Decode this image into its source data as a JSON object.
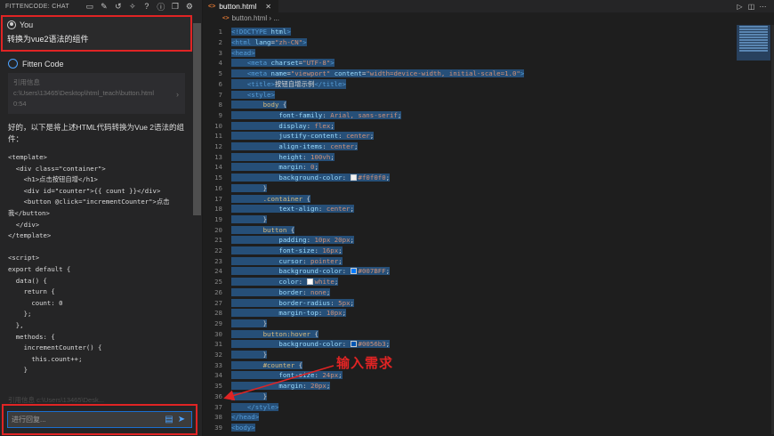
{
  "chat": {
    "header_title": "FITTENCODE: CHAT",
    "header_icons": [
      "chat-bubble-icon",
      "edit-icon",
      "history-icon",
      "wand-icon",
      "help-icon",
      "info-icon",
      "copy-window-icon",
      "gear-icon"
    ],
    "user": {
      "name": "You",
      "message": "转换为vue2语法的组件"
    },
    "bot": {
      "name": "Fitten Code"
    },
    "reference": {
      "label": "引用信息",
      "path": "c:\\Users\\13465\\Desktop\\html_teach\\button.html",
      "range": "0:54"
    },
    "answer_intro": "好的，以下是将上述HTML代码转换为Vue 2语法的组件：",
    "code_lines": [
      "<template>",
      "  <div class=\"container\">",
      "    <h1>点击按钮自增</h1>",
      "    <div id=\"counter\">{{ count }}</div>",
      "    <button @click=\"incrementCounter\">点击",
      "我</button>",
      "  </div>",
      "</template>",
      "",
      "<script>",
      "export default {",
      "  data() {",
      "    return {",
      "      count: 0",
      "    };",
      "  },",
      "  methods: {",
      "    incrementCounter() {",
      "      this.count++;",
      "    }"
    ],
    "reference_faded": "引用信息  c:\\Users\\13465\\Desk...",
    "input_placeholder": "进行回复...",
    "input_value": ""
  },
  "editor": {
    "tab_label": "button.html",
    "tab_icon": "<>",
    "breadcrumb": [
      "button.html",
      "..."
    ],
    "annotation": "输入需求",
    "accent": "#e02424",
    "lines": [
      [
        [
          "tg",
          "<!DOCTYPE "
        ],
        [
          "at",
          "html"
        ],
        [
          "tg",
          ">"
        ]
      ],
      [
        [
          "tg",
          "<html "
        ],
        [
          "at",
          "lang"
        ],
        [
          "tx",
          "="
        ],
        [
          "st",
          "\"zh-CN\""
        ],
        [
          "tg",
          ">"
        ]
      ],
      [
        [
          "tg",
          "<head>"
        ]
      ],
      [
        [
          "tx",
          "    "
        ],
        [
          "tg",
          "<meta "
        ],
        [
          "at",
          "charset"
        ],
        [
          "tx",
          "="
        ],
        [
          "st",
          "\"UTF-8\""
        ],
        [
          "tg",
          ">"
        ]
      ],
      [
        [
          "tx",
          "    "
        ],
        [
          "tg",
          "<meta "
        ],
        [
          "at",
          "name"
        ],
        [
          "tx",
          "="
        ],
        [
          "st",
          "\"viewport\""
        ],
        [
          "tx",
          " "
        ],
        [
          "at",
          "content"
        ],
        [
          "tx",
          "="
        ],
        [
          "st",
          "\"width=device-width, initial-scale=1.0\""
        ],
        [
          "tg",
          ">"
        ]
      ],
      [
        [
          "tx",
          "    "
        ],
        [
          "tg",
          "<title>"
        ],
        [
          "tx",
          "按钮自增示例"
        ],
        [
          "tg",
          "</title>"
        ]
      ],
      [
        [
          "tx",
          "    "
        ],
        [
          "tg",
          "<style>"
        ]
      ],
      [
        [
          "tx",
          "        "
        ],
        [
          "sl",
          "body"
        ],
        [
          "pn",
          " {"
        ]
      ],
      [
        [
          "tx",
          "            "
        ],
        [
          "pr",
          "font-family"
        ],
        [
          "pn",
          ": "
        ],
        [
          "vl",
          "Arial, sans-serif"
        ],
        [
          "pn",
          ";"
        ]
      ],
      [
        [
          "tx",
          "            "
        ],
        [
          "pr",
          "display"
        ],
        [
          "pn",
          ": "
        ],
        [
          "vl",
          "flex"
        ],
        [
          "pn",
          ";"
        ]
      ],
      [
        [
          "tx",
          "            "
        ],
        [
          "pr",
          "justify-content"
        ],
        [
          "pn",
          ": "
        ],
        [
          "vl",
          "center"
        ],
        [
          "pn",
          ";"
        ]
      ],
      [
        [
          "tx",
          "            "
        ],
        [
          "pr",
          "align-items"
        ],
        [
          "pn",
          ": "
        ],
        [
          "vl",
          "center"
        ],
        [
          "pn",
          ";"
        ]
      ],
      [
        [
          "tx",
          "            "
        ],
        [
          "pr",
          "height"
        ],
        [
          "pn",
          ": "
        ],
        [
          "vl",
          "100vh"
        ],
        [
          "pn",
          ";"
        ]
      ],
      [
        [
          "tx",
          "            "
        ],
        [
          "pr",
          "margin"
        ],
        [
          "pn",
          ": "
        ],
        [
          "vl",
          "0"
        ],
        [
          "pn",
          ";"
        ]
      ],
      [
        [
          "tx",
          "            "
        ],
        [
          "pr",
          "background-color"
        ],
        [
          "pn",
          ": "
        ],
        [
          "sw",
          "#f0f0f0"
        ],
        [
          "vl",
          "#f0f0f0"
        ],
        [
          "pn",
          ";"
        ]
      ],
      [
        [
          "tx",
          "        "
        ],
        [
          "pn",
          "}"
        ]
      ],
      [
        [
          "tx",
          "        "
        ],
        [
          "sl",
          ".container"
        ],
        [
          "pn",
          " {"
        ]
      ],
      [
        [
          "tx",
          "            "
        ],
        [
          "pr",
          "text-align"
        ],
        [
          "pn",
          ": "
        ],
        [
          "vl",
          "center"
        ],
        [
          "pn",
          ";"
        ]
      ],
      [
        [
          "tx",
          "        "
        ],
        [
          "pn",
          "}"
        ]
      ],
      [
        [
          "tx",
          "        "
        ],
        [
          "sl",
          "button"
        ],
        [
          "pn",
          " {"
        ]
      ],
      [
        [
          "tx",
          "            "
        ],
        [
          "pr",
          "padding"
        ],
        [
          "pn",
          ": "
        ],
        [
          "vl",
          "10px 20px"
        ],
        [
          "pn",
          ";"
        ]
      ],
      [
        [
          "tx",
          "            "
        ],
        [
          "pr",
          "font-size"
        ],
        [
          "pn",
          ": "
        ],
        [
          "vl",
          "16px"
        ],
        [
          "pn",
          ";"
        ]
      ],
      [
        [
          "tx",
          "            "
        ],
        [
          "pr",
          "cursor"
        ],
        [
          "pn",
          ": "
        ],
        [
          "vl",
          "pointer"
        ],
        [
          "pn",
          ";"
        ]
      ],
      [
        [
          "tx",
          "            "
        ],
        [
          "pr",
          "background-color"
        ],
        [
          "pn",
          ": "
        ],
        [
          "sw",
          "#007BFF"
        ],
        [
          "vl",
          "#007BFF"
        ],
        [
          "pn",
          ";"
        ]
      ],
      [
        [
          "tx",
          "            "
        ],
        [
          "pr",
          "color"
        ],
        [
          "pn",
          ": "
        ],
        [
          "sw",
          "#ffffff"
        ],
        [
          "vl",
          "white"
        ],
        [
          "pn",
          ";"
        ]
      ],
      [
        [
          "tx",
          "            "
        ],
        [
          "pr",
          "border"
        ],
        [
          "pn",
          ": "
        ],
        [
          "vl",
          "none"
        ],
        [
          "pn",
          ";"
        ]
      ],
      [
        [
          "tx",
          "            "
        ],
        [
          "pr",
          "border-radius"
        ],
        [
          "pn",
          ": "
        ],
        [
          "vl",
          "5px"
        ],
        [
          "pn",
          ";"
        ]
      ],
      [
        [
          "tx",
          "            "
        ],
        [
          "pr",
          "margin-top"
        ],
        [
          "pn",
          ": "
        ],
        [
          "vl",
          "10px"
        ],
        [
          "pn",
          ";"
        ]
      ],
      [
        [
          "tx",
          "        "
        ],
        [
          "pn",
          "}"
        ]
      ],
      [
        [
          "tx",
          "        "
        ],
        [
          "sl",
          "button:hover"
        ],
        [
          "pn",
          " {"
        ]
      ],
      [
        [
          "tx",
          "            "
        ],
        [
          "pr",
          "background-color"
        ],
        [
          "pn",
          ": "
        ],
        [
          "sw",
          "#0056b3"
        ],
        [
          "vl",
          "#0056b3"
        ],
        [
          "pn",
          ";"
        ]
      ],
      [
        [
          "tx",
          "        "
        ],
        [
          "pn",
          "}"
        ]
      ],
      [
        [
          "tx",
          "        "
        ],
        [
          "sl",
          "#counter"
        ],
        [
          "pn",
          " {"
        ]
      ],
      [
        [
          "tx",
          "            "
        ],
        [
          "pr",
          "font-size"
        ],
        [
          "pn",
          ": "
        ],
        [
          "vl",
          "24px"
        ],
        [
          "pn",
          ";"
        ]
      ],
      [
        [
          "tx",
          "            "
        ],
        [
          "pr",
          "margin"
        ],
        [
          "pn",
          ": "
        ],
        [
          "vl",
          "20px"
        ],
        [
          "pn",
          ";"
        ]
      ],
      [
        [
          "tx",
          "        "
        ],
        [
          "pn",
          "}"
        ]
      ],
      [
        [
          "tx",
          "    "
        ],
        [
          "tg",
          "</style>"
        ]
      ],
      [
        [
          "tg",
          "</head>"
        ]
      ],
      [
        [
          "tg",
          "<body>"
        ]
      ]
    ]
  }
}
